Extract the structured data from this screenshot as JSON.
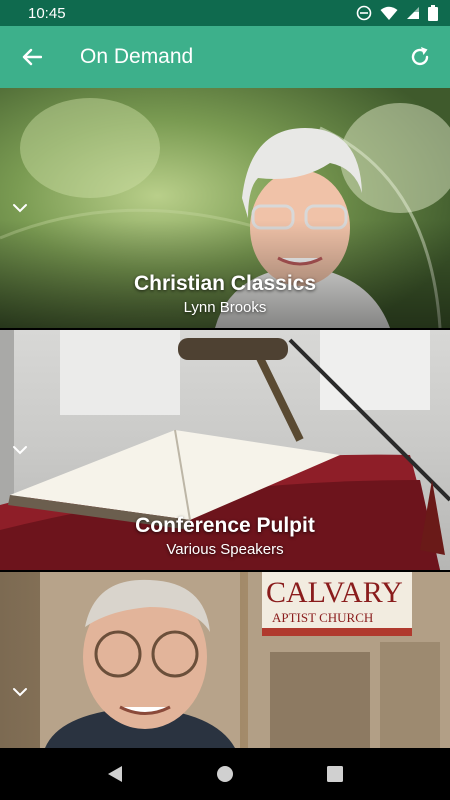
{
  "status_bar": {
    "time": "10:45"
  },
  "app_bar": {
    "title": "On Demand"
  },
  "cards": [
    {
      "title": "Christian Classics",
      "subtitle": "Lynn Brooks"
    },
    {
      "title": "Conference Pulpit",
      "subtitle": "Various Speakers"
    },
    {
      "title": "",
      "subtitle": "",
      "sign_text": "CALVARY",
      "sign_sub": "APTIST CHURCH"
    }
  ],
  "colors": {
    "status": "#0f6a4e",
    "appbar": "#3db08b"
  }
}
